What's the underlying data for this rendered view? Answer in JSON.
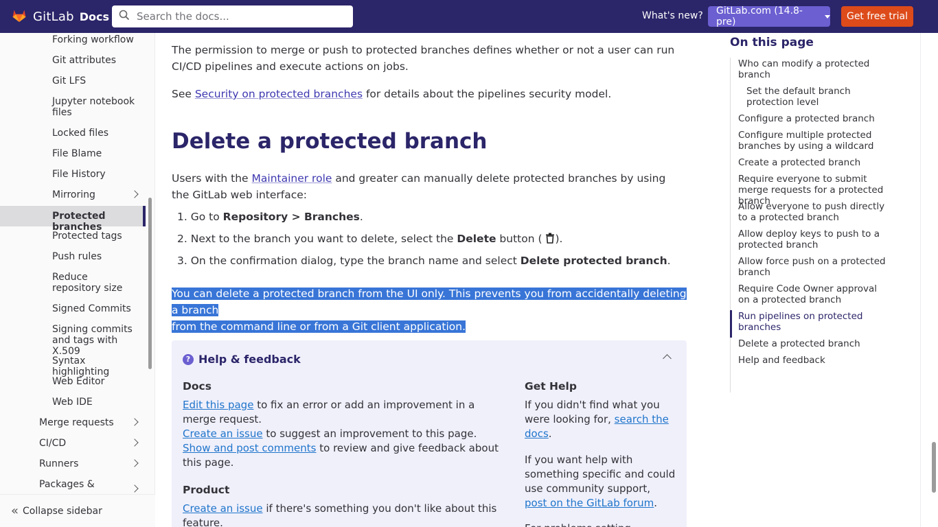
{
  "header": {
    "brand": "GitLab",
    "docs": "Docs",
    "search_placeholder": "Search the docs...",
    "whats_new": "What's new?",
    "version": "GitLab.com (14.8-pre)",
    "trial": "Get free trial"
  },
  "sidebar": {
    "items": [
      {
        "label": "Forking workflow"
      },
      {
        "label": "Git attributes"
      },
      {
        "label": "Git LFS"
      },
      {
        "label": "Jupyter notebook files"
      },
      {
        "label": "Locked files"
      },
      {
        "label": "File Blame"
      },
      {
        "label": "File History"
      },
      {
        "label": "Mirroring"
      },
      {
        "label": "Protected branches"
      },
      {
        "label": "Protected tags"
      },
      {
        "label": "Push rules"
      },
      {
        "label": "Reduce repository size"
      },
      {
        "label": "Signed Commits"
      },
      {
        "label": "Signing commits and tags with X.509"
      },
      {
        "label": "Syntax highlighting"
      },
      {
        "label": "Web Editor"
      },
      {
        "label": "Web IDE"
      },
      {
        "label": "Merge requests"
      },
      {
        "label": "CI/CD"
      },
      {
        "label": "Runners"
      },
      {
        "label": "Packages &"
      }
    ],
    "collapse": "Collapse sidebar"
  },
  "content": {
    "p1": "The permission to merge or push to protected branches defines whether or not a user can run CI/CD pipelines and execute actions on jobs.",
    "p2_pre": "See ",
    "p2_link": "Security on protected branches",
    "p2_post": " for details about the pipelines security model.",
    "heading": "Delete a protected branch",
    "p3_pre": "Users with the ",
    "p3_link": "Maintainer role",
    "p3_post": " and greater can manually delete protected branches by using the GitLab web interface:",
    "s1_num": "1.",
    "s1_pre": "Go to ",
    "s1_bold": "Repository > Branches",
    "s1_post": ".",
    "s2_num": "2.",
    "s2_pre": "Next to the branch you want to delete, select the ",
    "s2_bold": "Delete",
    "s2_post": " button (",
    "s2_end": ").",
    "s3_num": "3.",
    "s3_pre": "On the confirmation dialog, type the branch name and select ",
    "s3_bold": "Delete protected branch",
    "s3_post": ".",
    "selected_1": "You can delete a protected branch from the UI only. This prevents you from accidentally deleting a branch",
    "selected_2": "from the command line or from a Git client application."
  },
  "help": {
    "title": "Help & feedback",
    "docs_h": "Docs",
    "edit_link": "Edit this page",
    "edit_post": " to fix an error or add an improvement in a merge request.",
    "issue_link": "Create an issue",
    "issue_post": " to suggest an improvement to this page.",
    "comments_link": "Show and post comments",
    "comments_post": " to review and give feedback about this page.",
    "product_h": "Product",
    "product_link": "Create an issue",
    "product_post": " if there's something you don't like about this feature.",
    "gethelp_h": "Get Help",
    "gh1_pre": "If you didn't find what you were looking for, ",
    "gh1_link": "search the docs",
    "gh1_post": ".",
    "gh2_pre": "If you want help with something specific and could use community support, ",
    "gh2_link": "post on the GitLab forum",
    "gh2_post": ".",
    "gh3": "For problems setting"
  },
  "toc": {
    "title": "On this page",
    "items": [
      {
        "label": "Who can modify a protected branch"
      },
      {
        "label": "Set the default branch protection level"
      },
      {
        "label": "Configure a protected branch"
      },
      {
        "label": "Configure multiple protected branches by using a wildcard"
      },
      {
        "label": "Create a protected branch"
      },
      {
        "label": "Require everyone to submit merge requests for a protected branch"
      },
      {
        "label": "Allow everyone to push directly to a protected branch"
      },
      {
        "label": "Allow deploy keys to push to a protected branch"
      },
      {
        "label": "Allow force push on a protected branch"
      },
      {
        "label": "Require Code Owner approval on a protected branch"
      },
      {
        "label": "Run pipelines on protected branches"
      },
      {
        "label": "Delete a protected branch"
      },
      {
        "label": "Help and feedback"
      }
    ]
  },
  "colors": {
    "header_bg": "#2b2569",
    "version_btn": "#6b5fd1",
    "trial_btn": "#dd4b1a",
    "selection": "#3875d7",
    "help_bg": "#f0f0fb"
  },
  "icons": [
    "gitlab-logo-icon",
    "search-icon",
    "chevron-down-icon",
    "chevron-right-icon",
    "trash-icon",
    "question-icon",
    "chevron-up-icon",
    "double-chevron-left-icon"
  ]
}
